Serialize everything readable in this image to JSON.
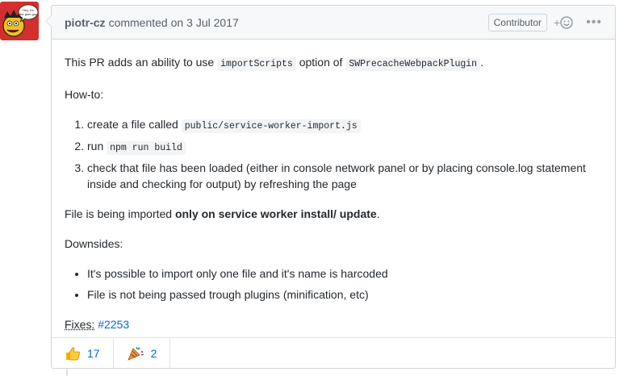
{
  "comment": {
    "author": "piotr-cz",
    "action": "commented on",
    "date": "3 Jul 2017",
    "badge": "Contributor",
    "react_button": "+",
    "more_button": "•••",
    "avatar_text_line1": "Hey, it's",
    "avatar_text_line2": "the ginn guy"
  },
  "body": {
    "intro_prefix": "This PR adds an ability to use ",
    "intro_code1": "importScripts",
    "intro_mid": " option of ",
    "intro_code2": "SWPrecacheWebpackPlugin",
    "intro_suffix": ".",
    "howto_label": "How-to:",
    "steps": [
      {
        "prefix": "create a file called ",
        "code": "public/service-worker-import.js",
        "suffix": ""
      },
      {
        "prefix": "run ",
        "code": "npm run build",
        "suffix": ""
      },
      {
        "prefix": "check that file has been loaded (either in console network panel or by placing console.log statement inside and checking for output) by refreshing the page",
        "code": "",
        "suffix": ""
      }
    ],
    "import_prefix": "File is being imported ",
    "import_bold": "only on service worker install/ update",
    "import_suffix": ".",
    "downsides_label": "Downsides:",
    "downsides": [
      "It's possible to import only one file and it's name is harcoded",
      "File is not being passed trough plugins (minification, etc)"
    ],
    "fixes_label": "Fixes:",
    "fixes_link": "#2253"
  },
  "reactions": [
    {
      "icon": "thumbs-up-icon",
      "count": "17"
    },
    {
      "icon": "party-popper-icon",
      "count": "2"
    }
  ]
}
